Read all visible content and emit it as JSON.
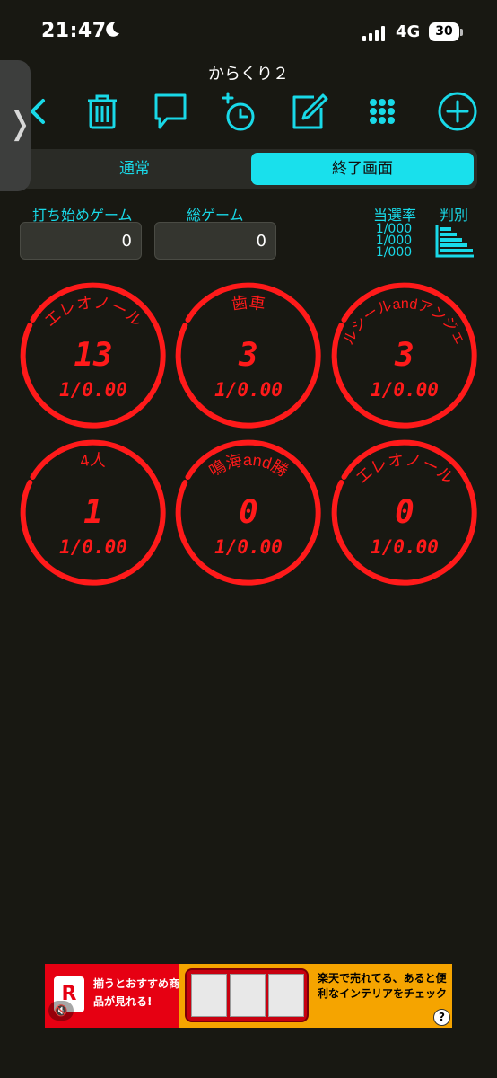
{
  "status": {
    "time": "21:47",
    "network": "4G",
    "battery": "30"
  },
  "app": {
    "title": "からくり２"
  },
  "toolbar": {
    "icons": [
      "back-icon",
      "trash-icon",
      "comment-icon",
      "add-timer-icon",
      "edit-icon",
      "grid-icon",
      "add-circle-icon"
    ]
  },
  "segmented": {
    "left_label": "通常",
    "right_label": "終了画面",
    "selected": "終了画面"
  },
  "counters": {
    "start_game_label": "打ち始めゲーム",
    "start_game_value": "0",
    "total_game_label": "総ゲーム",
    "total_game_value": "0",
    "probability_label": "当選率",
    "probabilities": [
      "1/000",
      "1/000",
      "1/000"
    ],
    "judge_label": "判別"
  },
  "cells": [
    {
      "name": "エレオノール",
      "count": "13",
      "ratio": "1/0.00"
    },
    {
      "name": "歯車",
      "count": "3",
      "ratio": "1/0.00"
    },
    {
      "name": "ルシールandアンジェ",
      "count": "3",
      "ratio": "1/0.00"
    },
    {
      "name": "4人",
      "count": "1",
      "ratio": "1/0.00"
    },
    {
      "name": "鳴海and勝",
      "count": "0",
      "ratio": "1/0.00"
    },
    {
      "name": "エレオノール",
      "count": "0",
      "ratio": "1/0.00"
    }
  ],
  "ad": {
    "logo": "R",
    "left_text": "揃うとおすすめ商品が見れる!",
    "right_text": "楽天で売れてる、あると便利なインテリアをチェック",
    "help": "?"
  },
  "colors": {
    "accent": "#19d9e8",
    "ring": "#ff1a1a",
    "background": "#181812"
  }
}
